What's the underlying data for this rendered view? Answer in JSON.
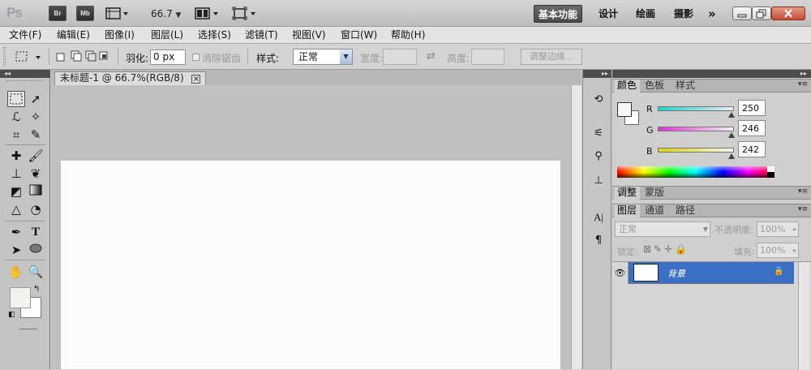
{
  "app": {
    "logo": "Ps",
    "bridge_label": "Br",
    "minibridge_label": "Mb",
    "zoom": "66.7",
    "workspaces": [
      "基本功能",
      "设计",
      "绘画",
      "摄影"
    ],
    "more_workspaces": "»"
  },
  "menu": [
    "文件(F)",
    "编辑(E)",
    "图像(I)",
    "图层(L)",
    "选择(S)",
    "滤镜(T)",
    "视图(V)",
    "窗口(W)",
    "帮助(H)"
  ],
  "options": {
    "feather_label": "羽化:",
    "feather_value": "0 px",
    "antialias_label": "消除锯齿",
    "style_label": "样式:",
    "style_value": "正常",
    "width_label": "宽度:",
    "height_label": "高度:",
    "refine_edge_label": "调整边缘..."
  },
  "document": {
    "tab_title": "未标题-1 @ 66.7%(RGB/8)",
    "close_glyph": "×"
  },
  "color_panel": {
    "tabs": [
      "颜色",
      "色板",
      "样式"
    ],
    "channels": [
      {
        "label": "R",
        "value": "250"
      },
      {
        "label": "G",
        "value": "246"
      },
      {
        "label": "B",
        "value": "242"
      }
    ]
  },
  "adjust_panel": {
    "tabs": [
      "调整",
      "蒙版"
    ]
  },
  "layers_panel": {
    "tabs": [
      "图层",
      "通道",
      "路径"
    ],
    "blend_mode": "正常",
    "opacity_label": "不透明度:",
    "opacity_value": "100%",
    "lock_label": "锁定:",
    "fill_label": "填充:",
    "fill_value": "100%",
    "layers": [
      {
        "name": "背景"
      }
    ]
  },
  "colors": {
    "selected_layer": "#3a6fc4",
    "foreground": "#faf6f2",
    "canvas": "#fcfcfc"
  }
}
